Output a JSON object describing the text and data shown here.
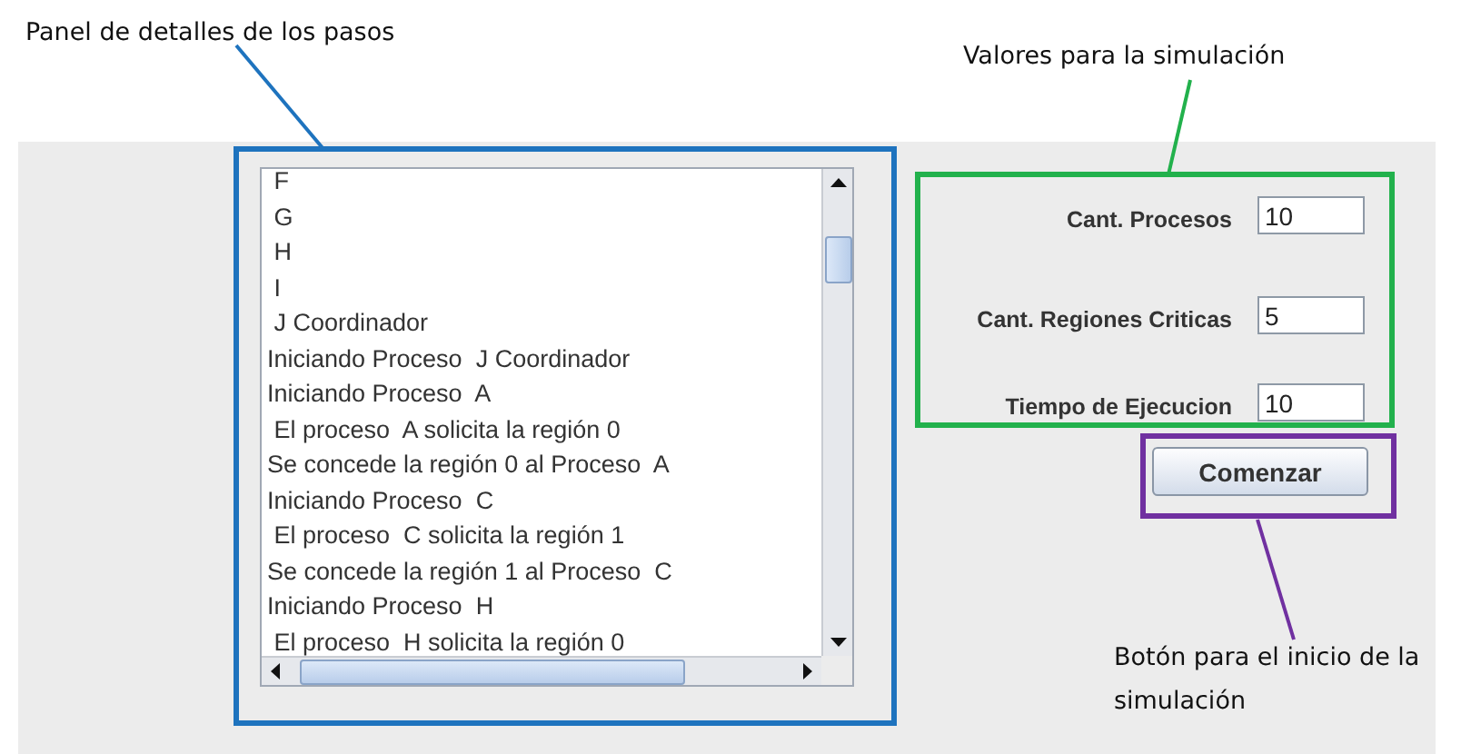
{
  "log_panel": {
    "lines": [
      " F",
      " G",
      " H",
      " I",
      " J Coordinador",
      "Iniciando Proceso  J Coordinador",
      "Iniciando Proceso  A",
      " El proceso  A solicita la región 0",
      "Se concede la región 0 al Proceso  A",
      "Iniciando Proceso  C",
      " El proceso  C solicita la región 1",
      "Se concede la región 1 al Proceso  C",
      "Iniciando Proceso  H",
      " El proceso  H solicita la región 0"
    ]
  },
  "form": {
    "fields": [
      {
        "label": "Cant. Procesos",
        "value": "10"
      },
      {
        "label": "Cant. Regiones Criticas",
        "value": "5"
      },
      {
        "label": "Tiempo de Ejecucion",
        "value": "10"
      }
    ],
    "button": "Comenzar"
  },
  "annotations": [
    {
      "text": "Panel de detalles de los pasos",
      "color": "#1e73be"
    },
    {
      "text": "Valores para la simulación",
      "color": "#22b14c"
    },
    {
      "text": "Botón para el inicio de la simulación",
      "color": "#7030a0"
    }
  ]
}
